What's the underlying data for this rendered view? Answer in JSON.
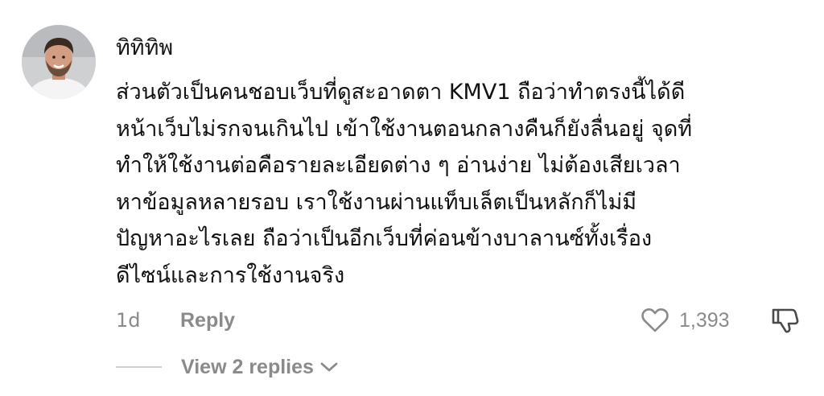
{
  "comment": {
    "username": "ทิทิทิพ",
    "text": "ส่วนตัวเป็นคนชอบเว็บที่ดูสะอาดตา KMV1 ถือว่าทำตรงนี้ได้ดี\nหน้าเว็บไม่รกจนเกินไป เข้าใช้งานตอนกลางคืนก็ยังลื่นอยู่ จุดที่\nทำให้ใช้งานต่อคือรายละเอียดต่าง ๆ อ่านง่าย ไม่ต้องเสียเวลา\nหาข้อมูลหลายรอบ เราใช้งานผ่านแท็บเล็ตเป็นหลักก็ไม่มี\nปัญหาอะไรเลย ถือว่าเป็นอีกเว็บที่ค่อนข้างบาลานซ์ทั้งเรื่อง\nดีไซน์และการใช้งานจริง",
    "timestamp": "1d",
    "reply_label": "Reply",
    "like_count": "1,393",
    "view_replies_label": "View 2 replies"
  },
  "icons": {
    "avatar": "user-avatar",
    "like": "heart-outline-icon",
    "dislike": "thumbs-down-outline-icon",
    "expand": "chevron-down-icon"
  },
  "colors": {
    "secondary_text": "#8a8a8a",
    "primary_text": "#111111",
    "background": "#ffffff"
  }
}
